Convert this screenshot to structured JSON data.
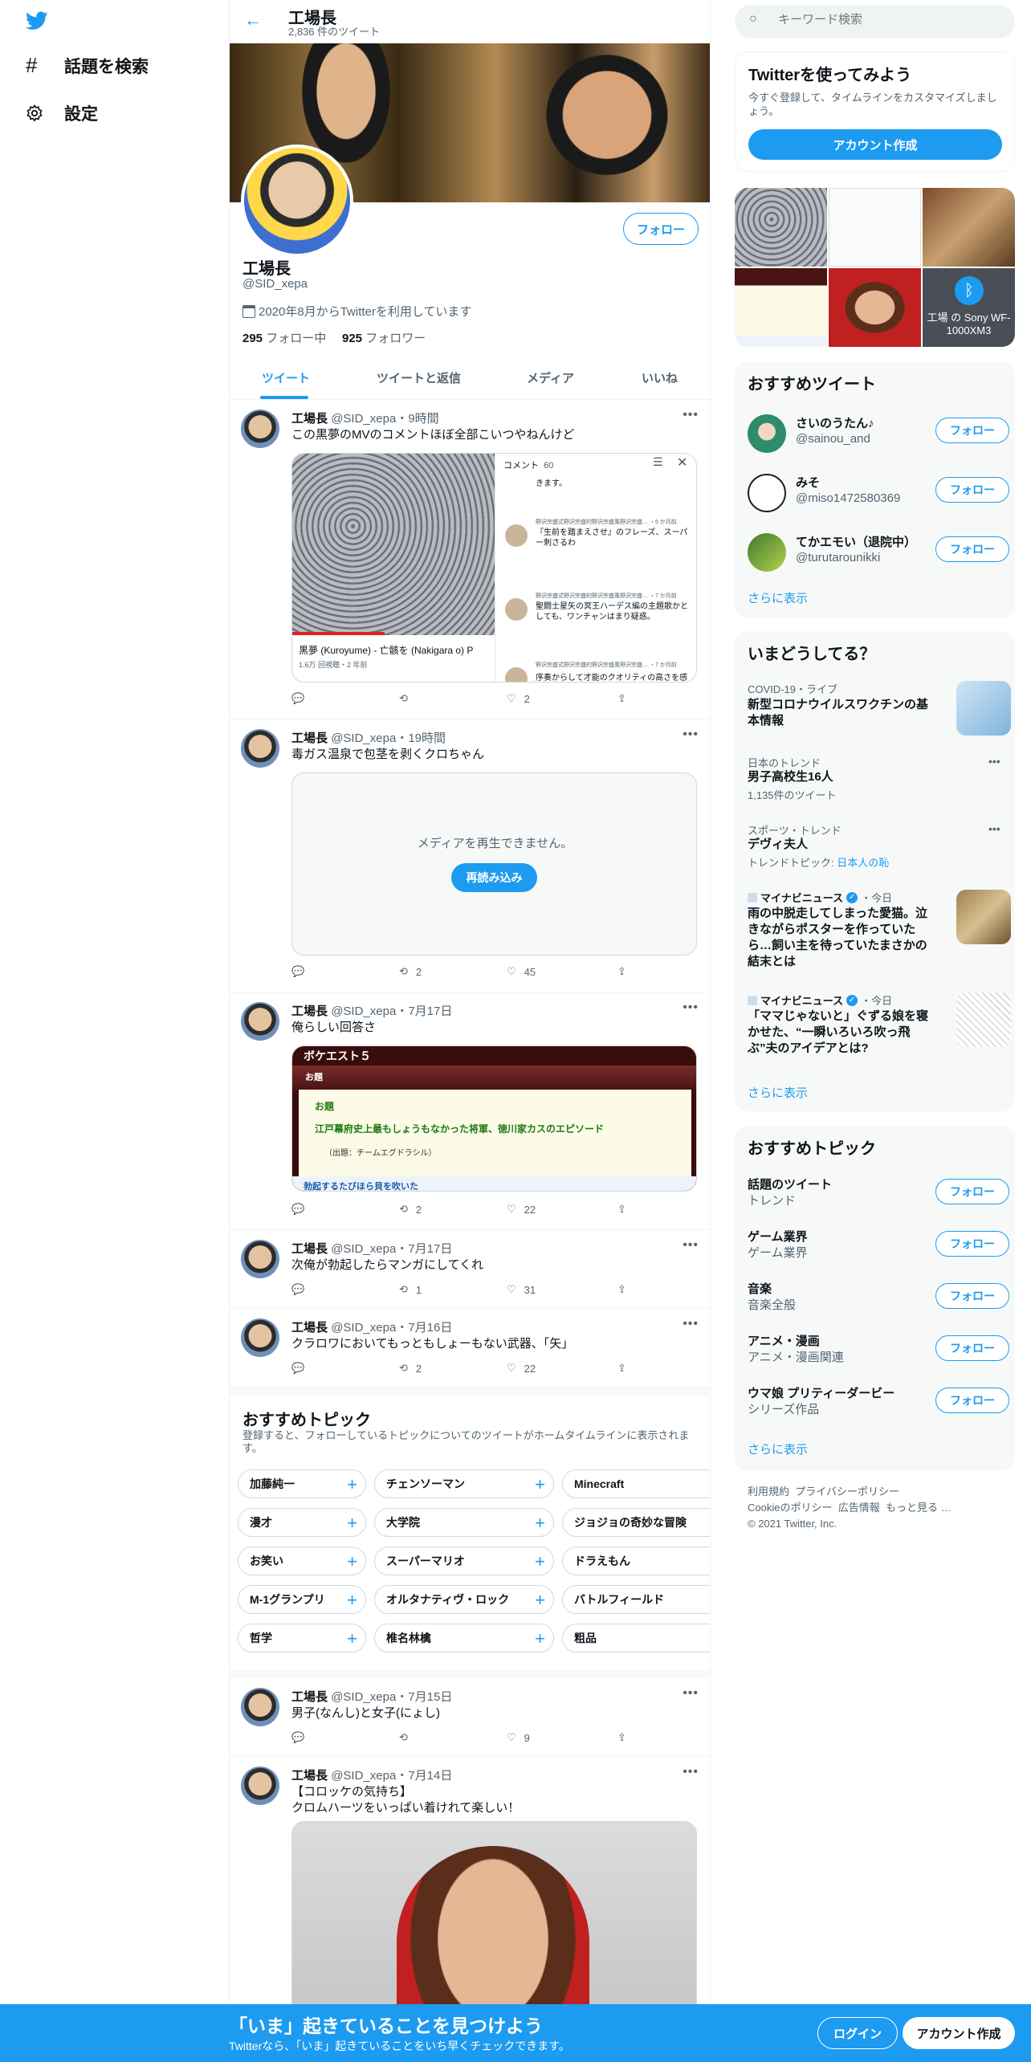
{
  "nav": {
    "items": [
      {
        "label": "話題を検索",
        "icon": "hashtag-icon"
      },
      {
        "label": "設定",
        "icon": "gear-icon"
      }
    ]
  },
  "profile": {
    "header_name": "工場長",
    "tweet_count": "2,836 件のツイート",
    "name": "工場長",
    "handle": "@SID_xepa",
    "joined": "2020年8月からTwitterを利用しています",
    "following_count": "295",
    "following_label": "フォロー中",
    "followers_count": "925",
    "followers_label": "フォロワー",
    "follow_button": "フォロー"
  },
  "tabs": [
    "ツイート",
    "ツイートと返信",
    "メディア",
    "いいね"
  ],
  "tweets": [
    {
      "name": "工場長",
      "handle": "@SID_xepa",
      "time": "9時間",
      "text": "この黒夢のMVのコメントほぼ全部こいつやねんけど",
      "media": {
        "comment_header": "コメント",
        "comment_count": "60",
        "video_title": "黒夢 (Kuroyume) - 亡骸を (Nakigara o) P",
        "video_meta": "1.6万 回視聴・2 年前",
        "comment_1": "きます。",
        "comment_2_meta": "野沢宗盛式野沢宗盛的野沢宗盛風野沢宗盛… ・5 か月前",
        "comment_2": "『生前を踏まえさせ』のフレーズ、スーパー刺さるわ",
        "comment_3_meta": "野沢宗盛式野沢宗盛的野沢宗盛風野沢宗盛… ・7 か月前",
        "comment_3": "聖闘士星矢の冥王ハーデス編の主題歌かとしても、ワンチャンはまり疑惑。",
        "comment_4_meta": "野沢宗盛式野沢宗盛的野沢宗盛風野沢宗盛… ・7 か月前",
        "comment_4": "序奏からして才能のクオリティの高さを感じ"
      },
      "replies": "",
      "retweets": "",
      "likes": "2"
    },
    {
      "name": "工場長",
      "handle": "@SID_xepa",
      "time": "19時間",
      "text": "毒ガス温泉で包茎を剥くクロちゃん",
      "media_error": "メディアを再生できません。",
      "reload": "再読み込み",
      "replies": "",
      "retweets": "2",
      "likes": "45"
    },
    {
      "name": "工場長",
      "handle": "@SID_xepa",
      "time": "7月17日",
      "text": "俺らしい回答さ",
      "quiz": {
        "title": "ボケエスト５",
        "label": "お題",
        "inner_label": "お題",
        "question": "江戸幕府史上最もしょうもなかった将軍、徳川家カスのエピソード",
        "credit": "（出題：チームエグドラシル）",
        "answer": "勃起するたびほら貝を吹いた"
      },
      "replies": "",
      "retweets": "2",
      "likes": "22"
    },
    {
      "name": "工場長",
      "handle": "@SID_xepa",
      "time": "7月17日",
      "text": "次俺が勃起したらマンガにしてくれ",
      "replies": "",
      "retweets": "1",
      "likes": "31"
    },
    {
      "name": "工場長",
      "handle": "@SID_xepa",
      "time": "7月16日",
      "text": "クラロワにおいてもっともしょーもない武器、「矢」",
      "replies": "",
      "retweets": "2",
      "likes": "22"
    },
    {
      "name": "工場長",
      "handle": "@SID_xepa",
      "time": "7月15日",
      "text": "男子(なんし)と女子(にょし)",
      "replies": "",
      "retweets": "",
      "likes": "9"
    },
    {
      "name": "工場長",
      "handle": "@SID_xepa",
      "time": "7月14日",
      "text": "【コロッケの気持ち】",
      "text2": "クロムハーツをいっぱい着けれて楽しい！"
    }
  ],
  "topics_block": {
    "title": "おすすめトピック",
    "desc": "登録すると、フォローしているトピックについてのツイートがホームタイムラインに表示されます。",
    "chips": [
      [
        "加藤純一",
        "チェンソーマン",
        "Minecraft"
      ],
      [
        "漫才",
        "大学院",
        "ジョジョの奇妙な冒険"
      ],
      [
        "お笑い",
        "スーパーマリオ",
        "ドラえもん"
      ],
      [
        "M-1グランプリ",
        "オルタナティヴ・ロック",
        "バトルフィールド"
      ],
      [
        "哲学",
        "椎名林檎",
        "粗品"
      ]
    ]
  },
  "right": {
    "search_placeholder": "キーワード検索",
    "signup": {
      "title": "Twitterを使ってみよう",
      "desc": "今すぐ登録して、タイムラインをカスタマイズしましょう。",
      "button": "アカウント作成"
    },
    "media_grid": {
      "bluetooth_caption": "工場 の Sony WF-1000XM3"
    },
    "recommended_tweets": {
      "title": "おすすめツイート",
      "users": [
        {
          "name": "さいのうたん♪",
          "handle": "@sainou_and"
        },
        {
          "name": "みそ",
          "handle": "@miso1472580369"
        },
        {
          "name": "てかエモい（退院中）",
          "handle": "@turutarounikki"
        }
      ],
      "follow": "フォロー",
      "more": "さらに表示"
    },
    "trends": {
      "title": "いまどうしてる？",
      "items": [
        {
          "meta": "COVID-19・ライブ",
          "title": "新型コロナウイルスワクチンの基本情報"
        },
        {
          "meta": "日本のトレンド",
          "title": "男子高校生16人",
          "sub": "1,135件のツイート"
        },
        {
          "meta": "スポーツ・トレンド",
          "title": "デヴィ夫人",
          "sub_prefix": "トレンドトピック:",
          "sub_link": "日本人の恥"
        },
        {
          "meta_name": "マイナビニュース",
          "meta_time": "・今日",
          "title": "雨の中脱走してしまった愛猫。泣きながらポスターを作っていたら…飼い主を待っていたまさかの結末とは"
        },
        {
          "meta_name": "マイナビニュース",
          "meta_time": "・今日",
          "title": "「ママじゃないと」ぐずる娘を寝かせた、“一瞬いろいろ吹っ飛ぶ”夫のアイデアとは?"
        }
      ],
      "more": "さらに表示"
    },
    "topics": {
      "title": "おすすめトピック",
      "items": [
        {
          "name": "話題のツイート",
          "sub": "トレンド"
        },
        {
          "name": "ゲーム業界",
          "sub": "ゲーム業界"
        },
        {
          "name": "音楽",
          "sub": "音楽全般"
        },
        {
          "name": "アニメ・漫画",
          "sub": "アニメ・漫画関連"
        },
        {
          "name": "ウマ娘 プリティーダービー",
          "sub": "シリーズ作品"
        }
      ],
      "follow": "フォロー",
      "more": "さらに表示"
    },
    "footer": {
      "links1": [
        "利用規約",
        "プライバシーポリシー"
      ],
      "links2": [
        "Cookieのポリシー",
        "広告情報",
        "もっと見る …"
      ],
      "copyright": "© 2021 Twitter, Inc."
    }
  },
  "bottom_bar": {
    "title": "「いま」起きていることを見つけよう",
    "sub": "Twitterなら、「いま」起きていることをいち早くチェックできます。",
    "login": "ログイン",
    "signup": "アカウント作成"
  },
  "colors": {
    "accent": "#1d9bf0",
    "text": "#0f1419",
    "muted": "#536471",
    "card_bg": "#f7f9f9"
  }
}
